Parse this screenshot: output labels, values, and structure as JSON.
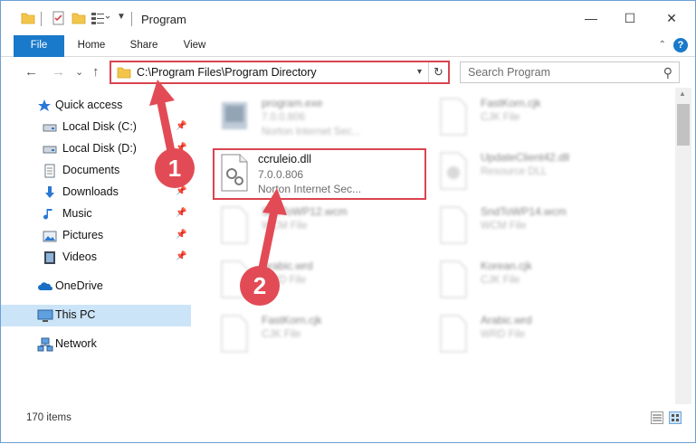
{
  "window": {
    "title": "Program",
    "minimize": "—",
    "maximize": "☐",
    "close": "✕"
  },
  "ribbon": {
    "tabs": [
      "File",
      "Home",
      "Share",
      "View"
    ],
    "help": "?"
  },
  "nav": {
    "back": "←",
    "forward": "→",
    "recent": "⌄",
    "up": "↑",
    "address": "C:\\Program Files\\Program Directory",
    "refresh": "↻",
    "search_placeholder": "Search Program"
  },
  "sidebar": {
    "items": [
      {
        "label": "Quick access",
        "icon": "star-icon",
        "pinned": false
      },
      {
        "label": "Local Disk (C:)",
        "icon": "drive-icon",
        "pinned": true
      },
      {
        "label": "Local Disk (D:)",
        "icon": "drive-icon",
        "pinned": true
      },
      {
        "label": "Documents",
        "icon": "documents-icon",
        "pinned": true
      },
      {
        "label": "Downloads",
        "icon": "download-icon",
        "pinned": true
      },
      {
        "label": "Music",
        "icon": "music-icon",
        "pinned": true
      },
      {
        "label": "Pictures",
        "icon": "pictures-icon",
        "pinned": true
      },
      {
        "label": "Videos",
        "icon": "videos-icon",
        "pinned": true
      },
      {
        "label": "OneDrive",
        "icon": "cloud-icon",
        "pinned": false
      },
      {
        "label": "This PC",
        "icon": "computer-icon",
        "pinned": false
      },
      {
        "label": "Network",
        "icon": "network-icon",
        "pinned": false
      }
    ]
  },
  "files": [
    {
      "name": "program.exe",
      "line2": "7.0.0.806",
      "line3": "Norton Internet Sec...",
      "blurred": true
    },
    {
      "name": "FastKorn.cjk",
      "line2": "CJK File",
      "line3": "",
      "blurred": true
    },
    {
      "name": "ccruleio.dll",
      "line2": "7.0.0.806",
      "line3": "Norton Internet Sec...",
      "blurred": false
    },
    {
      "name": "UpdateClient42.dll",
      "line2": "Resource DLL",
      "line3": "",
      "blurred": true
    },
    {
      "name": "SndToWP12.wcm",
      "line2": "WCM File",
      "line3": "",
      "blurred": true
    },
    {
      "name": "SndToWP14.wcm",
      "line2": "WCM File",
      "line3": "",
      "blurred": true
    },
    {
      "name": "Arabic.wrd",
      "line2": "WRD File",
      "line3": "",
      "blurred": true
    },
    {
      "name": "Korean.cjk",
      "line2": "CJK File",
      "line3": "",
      "blurred": true
    },
    {
      "name": "FastKorn.cjk",
      "line2": "CJK File",
      "line3": "",
      "blurred": true
    },
    {
      "name": "Arabic.wrd",
      "line2": "WRD File",
      "line3": "",
      "blurred": true
    }
  ],
  "status": {
    "count": "170 items"
  },
  "annotations": {
    "step1": "1",
    "step2": "2",
    "accent": "#e24b55"
  },
  "colors": {
    "file_tab": "#1979ca",
    "highlight": "#d94450",
    "selected": "#cce4f7"
  }
}
